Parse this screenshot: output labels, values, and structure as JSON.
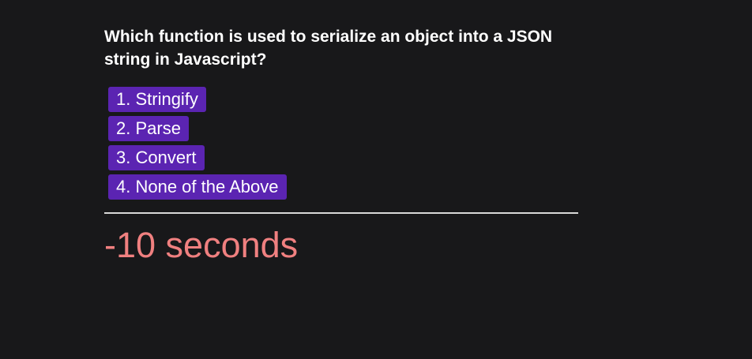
{
  "question": {
    "text": "Which function is used to serialize an object into a JSON string in Javascript?"
  },
  "options": [
    {
      "label": "1. Stringify"
    },
    {
      "label": "2. Parse"
    },
    {
      "label": "3. Convert"
    },
    {
      "label": "4. None of the Above"
    }
  ],
  "timer": {
    "text": "-10 seconds"
  },
  "colors": {
    "background": "#18181a",
    "option_background": "#5b24b2",
    "timer_text": "#f08080",
    "divider": "#d8d8d8"
  }
}
